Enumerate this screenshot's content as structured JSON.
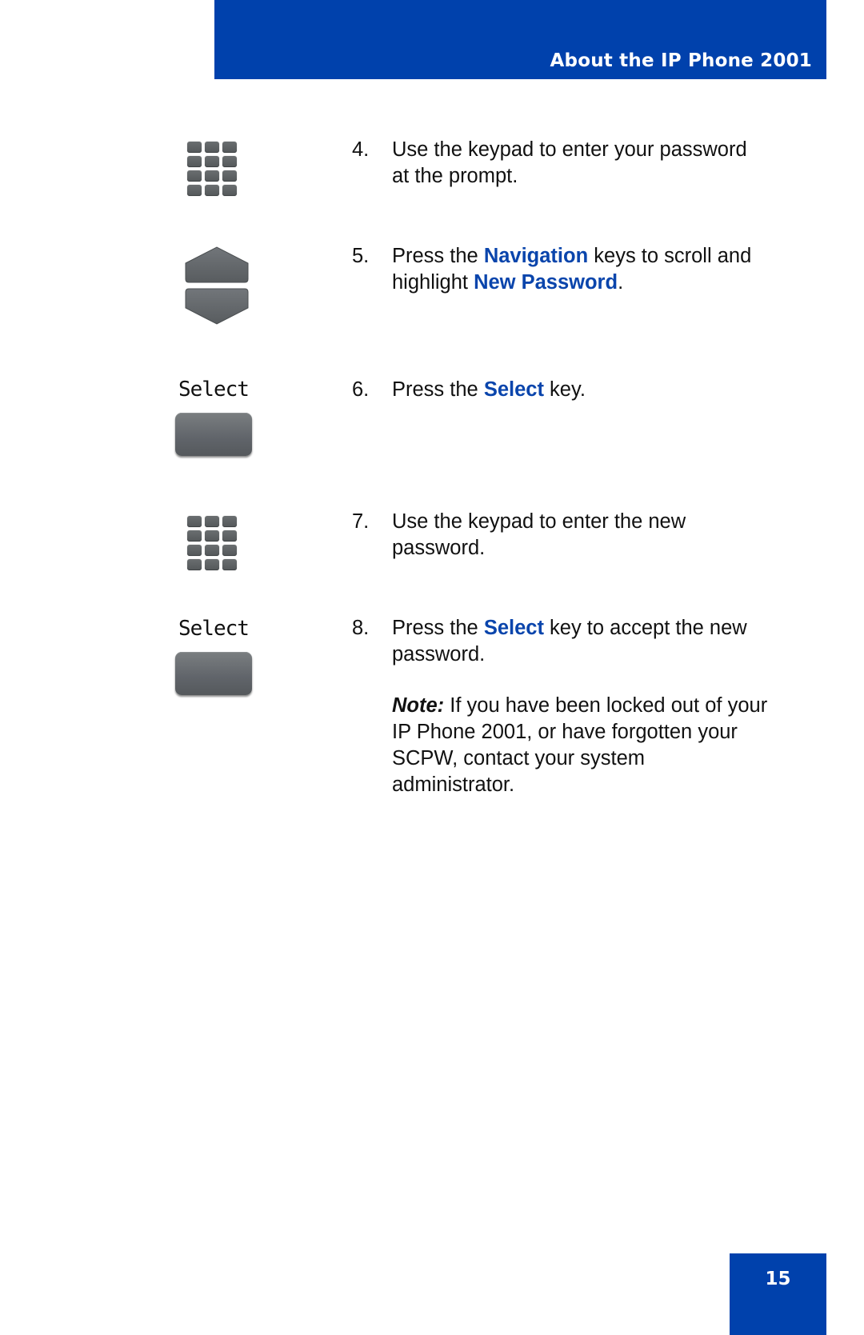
{
  "header": {
    "title": "About the IP Phone 2001"
  },
  "colors": {
    "brand_blue": "#0041ac",
    "keyword_blue": "#0a45ac"
  },
  "steps": [
    {
      "number": "4.",
      "icon": "keypad-icon",
      "parts": [
        "Use the keypad to enter your password at the prompt."
      ]
    },
    {
      "number": "5.",
      "icon": "navigation-keys-icon",
      "parts": [
        "Press the ",
        "Navigation",
        " keys to scroll and highlight ",
        "New Password",
        "."
      ]
    },
    {
      "number": "6.",
      "icon": "select-softkey-icon",
      "icon_label": "Select",
      "parts": [
        "Press the ",
        "Select",
        " key."
      ]
    },
    {
      "number": "7.",
      "icon": "keypad-icon",
      "parts": [
        "Use the keypad to enter the new password."
      ]
    },
    {
      "number": "8.",
      "icon": "select-softkey-icon",
      "icon_label": "Select",
      "parts": [
        "Press the ",
        "Select",
        " key to accept the new password."
      ]
    }
  ],
  "note": {
    "label": "Note:",
    "text": " If you have been locked out of your IP Phone 2001, or have forgotten your SCPW, contact your system administrator."
  },
  "footer": {
    "page_number": "15"
  }
}
